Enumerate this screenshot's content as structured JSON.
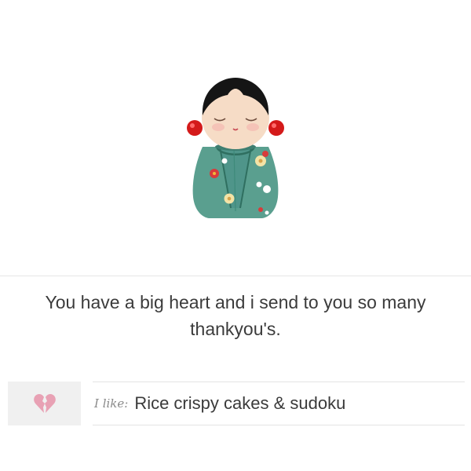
{
  "product": {
    "image_icon": "kokeshi-doll-image"
  },
  "message": {
    "text": "You have a big heart and i send to you so many thankyou's."
  },
  "likes": {
    "icon": "broken-heart-icon",
    "prefix": "I like:",
    "value": "Rice crispy cakes & sudoku"
  },
  "colors": {
    "heart": "#e8a1b4",
    "dress": "#5a9f8f",
    "earrings": "#d41a1a"
  }
}
